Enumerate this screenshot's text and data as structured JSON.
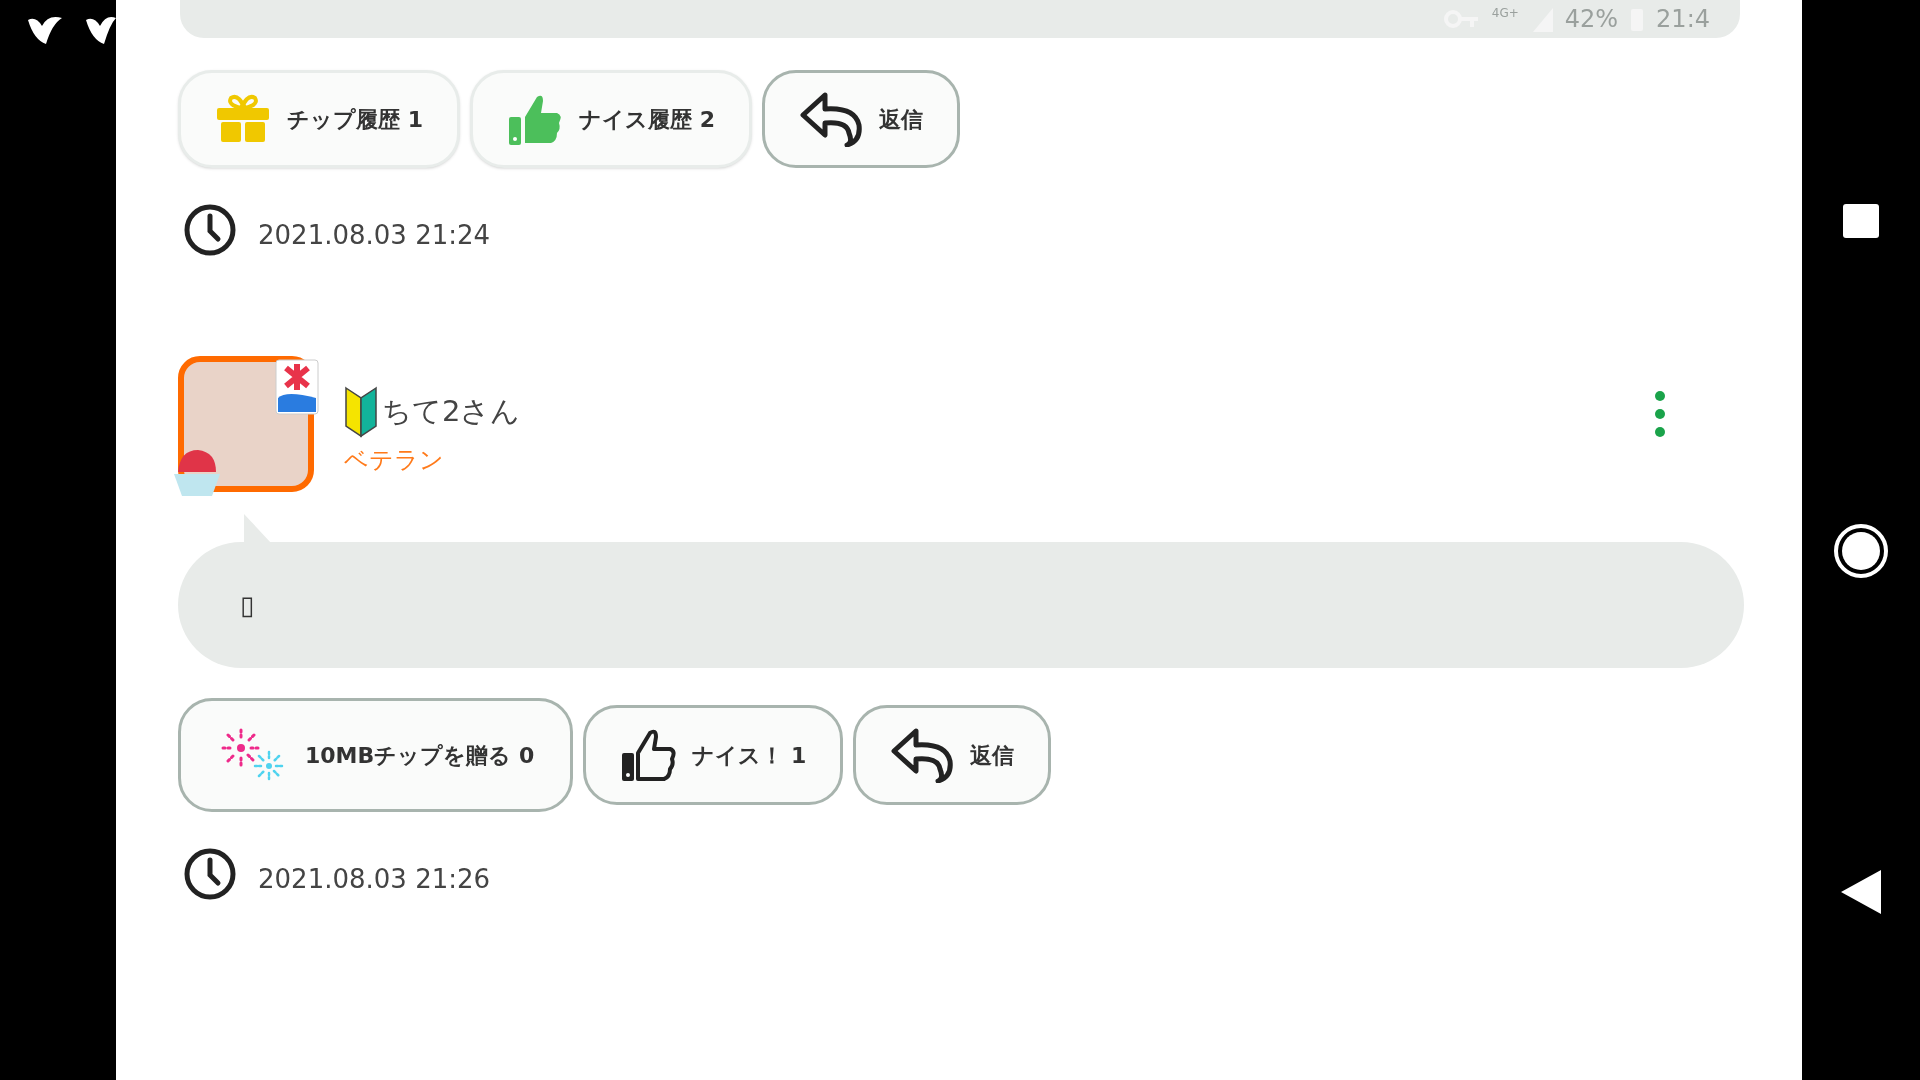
{
  "status_bar": {
    "network": "4G+",
    "battery": "42%",
    "time": "21:4"
  },
  "posts": [
    {
      "actions": [
        {
          "kind": "gift",
          "label": "チップ履歴 1"
        },
        {
          "kind": "thumb-filled",
          "label": "ナイス履歴 2"
        },
        {
          "kind": "reply",
          "label": "返信"
        }
      ],
      "timestamp": "2021.08.03 21:24"
    },
    {
      "user": {
        "name": "ちて2さん",
        "rank": "ベテラン"
      },
      "message": "▯",
      "actions": [
        {
          "kind": "fireworks",
          "label": "10MBチップを贈る 0"
        },
        {
          "kind": "thumb-outline",
          "label": "ナイス！ 1"
        },
        {
          "kind": "reply",
          "label": "返信"
        }
      ],
      "timestamp": "2021.08.03 21:26"
    }
  ]
}
